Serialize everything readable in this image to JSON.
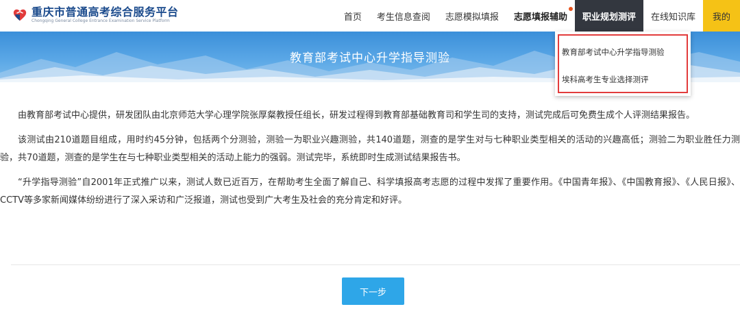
{
  "header": {
    "logo_title": "重庆市普通高考综合服务平台",
    "logo_subtitle": "Chongqing General College Entrance Examination Service Platform",
    "nav": [
      {
        "label": "首页"
      },
      {
        "label": "考生信息查阅"
      },
      {
        "label": "志愿模拟填报"
      },
      {
        "label": "志愿填报辅助"
      },
      {
        "label": "职业规划测评"
      },
      {
        "label": "在线知识库"
      },
      {
        "label": "我的"
      }
    ]
  },
  "banner": {
    "title": "教育部考试中心升学指导测验"
  },
  "dropdown": {
    "items": [
      {
        "label": "教育部考试中心升学指导测验"
      },
      {
        "label": "埃科高考生专业选择测评"
      }
    ]
  },
  "content": {
    "paragraphs": [
      "由教育部考试中心提供，研发团队由北京师范大学心理学院张厚粲教授任组长，研发过程得到教育部基础教育司和学生司的支持，测试完成后可免费生成个人评测结果报告。",
      "该测试由210道题目组成，用时约45分钟，包括两个分测验，测验一为职业兴趣测验，共140道题，测查的是学生对与七种职业类型相关的活动的兴趣高低；测验二为职业胜任力测验，共70道题，测查的是学生在与七种职业类型相关的活动上能力的强弱。测试完毕，系统即时生成测试结果报告书。",
      "“升学指导测验”自2001年正式推广以来，测试人数已近百万，在帮助考生全面了解自己、科学填报高考志愿的过程中发挥了重要作用。《中国青年报》、《中国教育报》、《人民日报》、CCTV等多家新闻媒体纷纷进行了深入采访和广泛报道，测试也受到广大考生及社会的充分肯定和好评。"
    ],
    "next_label": "下一步"
  },
  "colors": {
    "brand": "#1a4a8c",
    "nav_active_bg": "#33373f",
    "nav_mine_bg": "#f5c216",
    "highlight_border": "#e23b3b",
    "button": "#2ea6e8",
    "notify_dot": "#e8541e"
  },
  "icons": {
    "logo": "heart-logo-icon"
  }
}
